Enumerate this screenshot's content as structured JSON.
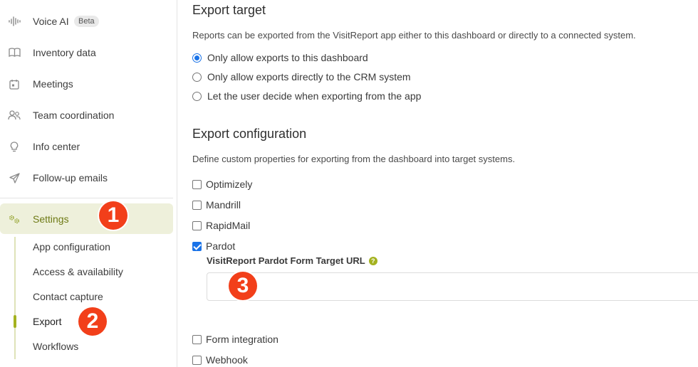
{
  "sidebar": {
    "items": [
      {
        "label": "Voice AI",
        "badge": "Beta",
        "icon": "waveform-icon"
      },
      {
        "label": "Inventory data",
        "icon": "book-icon"
      },
      {
        "label": "Meetings",
        "icon": "calendar-icon"
      },
      {
        "label": "Team coordination",
        "icon": "team-icon"
      },
      {
        "label": "Info center",
        "icon": "lightbulb-icon"
      },
      {
        "label": "Follow-up emails",
        "icon": "send-icon"
      }
    ],
    "settings": {
      "label": "Settings",
      "icon": "gears-icon"
    },
    "sub_items": [
      {
        "label": "App configuration"
      },
      {
        "label": "Access & availability"
      },
      {
        "label": "Contact capture"
      },
      {
        "label": "Export",
        "active": true
      },
      {
        "label": "Workflows"
      }
    ]
  },
  "markers": [
    "1",
    "2",
    "3"
  ],
  "export_target": {
    "title": "Export target",
    "description": "Reports can be exported from the VisitReport app either to this dashboard or directly to a connected system.",
    "options": [
      {
        "label": "Only allow exports to this dashboard",
        "selected": true
      },
      {
        "label": "Only allow exports directly to the CRM system",
        "selected": false
      },
      {
        "label": "Let the user decide when exporting from the app",
        "selected": false
      }
    ]
  },
  "export_config": {
    "title": "Export configuration",
    "description": "Define custom properties for exporting from the dashboard into target systems.",
    "options": [
      {
        "label": "Optimizely",
        "checked": false
      },
      {
        "label": "Mandrill",
        "checked": false
      },
      {
        "label": "RapidMail",
        "checked": false
      },
      {
        "label": "Pardot",
        "checked": true
      },
      {
        "label": "Form integration",
        "checked": false
      },
      {
        "label": "Webhook",
        "checked": false
      }
    ],
    "pardot_field": {
      "label": "VisitReport Pardot Form Target URL",
      "help": "?",
      "value": ""
    }
  },
  "colors": {
    "accent": "#a4b21f",
    "settings_bg": "#eef0db",
    "marker": "#f23f1a",
    "checkbox": "#1a73e8"
  }
}
